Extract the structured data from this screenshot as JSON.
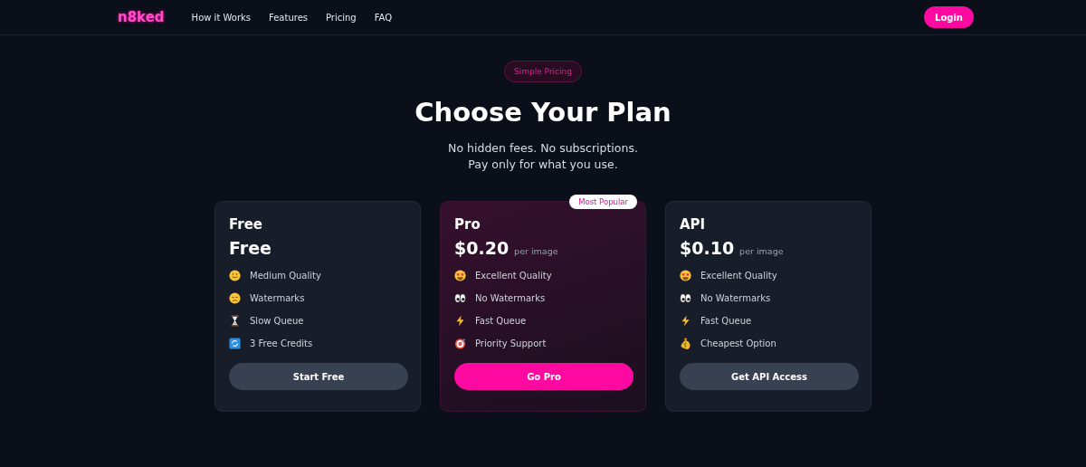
{
  "nav": {
    "logo": "n8ked",
    "links": [
      "How it Works",
      "Features",
      "Pricing",
      "FAQ"
    ],
    "login": "Login"
  },
  "hero": {
    "badge": "Simple Pricing",
    "title": "Choose Your Plan",
    "subtitle_lines": [
      "No hidden fees. No subscriptions.",
      "Pay only for what you use."
    ]
  },
  "plans": [
    {
      "name": "Free",
      "price": "Free",
      "featured": false,
      "features": [
        {
          "kind": "smile",
          "text": "Medium Quality"
        },
        {
          "kind": "sad",
          "text": "Watermarks"
        },
        {
          "kind": "hourglass",
          "text": "Slow Queue"
        },
        {
          "kind": "refresh",
          "text": "3 Free Credits"
        }
      ],
      "button": "Start Free"
    },
    {
      "name": "Pro",
      "price": "$0.20",
      "unit": "per image",
      "featured": true,
      "badge": "Most Popular",
      "features": [
        {
          "kind": "starstruck",
          "text": "Excellent Quality"
        },
        {
          "kind": "eyes",
          "text": "No Watermarks"
        },
        {
          "kind": "bolt",
          "text": "Fast Queue"
        },
        {
          "kind": "target",
          "text": "Priority Support"
        }
      ],
      "button": "Go Pro"
    },
    {
      "name": "API",
      "price": "$0.10",
      "unit": "per image",
      "featured": false,
      "features": [
        {
          "kind": "starstruck",
          "text": "Excellent Quality"
        },
        {
          "kind": "eyes",
          "text": "No Watermarks"
        },
        {
          "kind": "bolt",
          "text": "Fast Queue"
        },
        {
          "kind": "moneybag",
          "text": "Cheapest Option"
        }
      ],
      "button": "Get API Access"
    }
  ]
}
